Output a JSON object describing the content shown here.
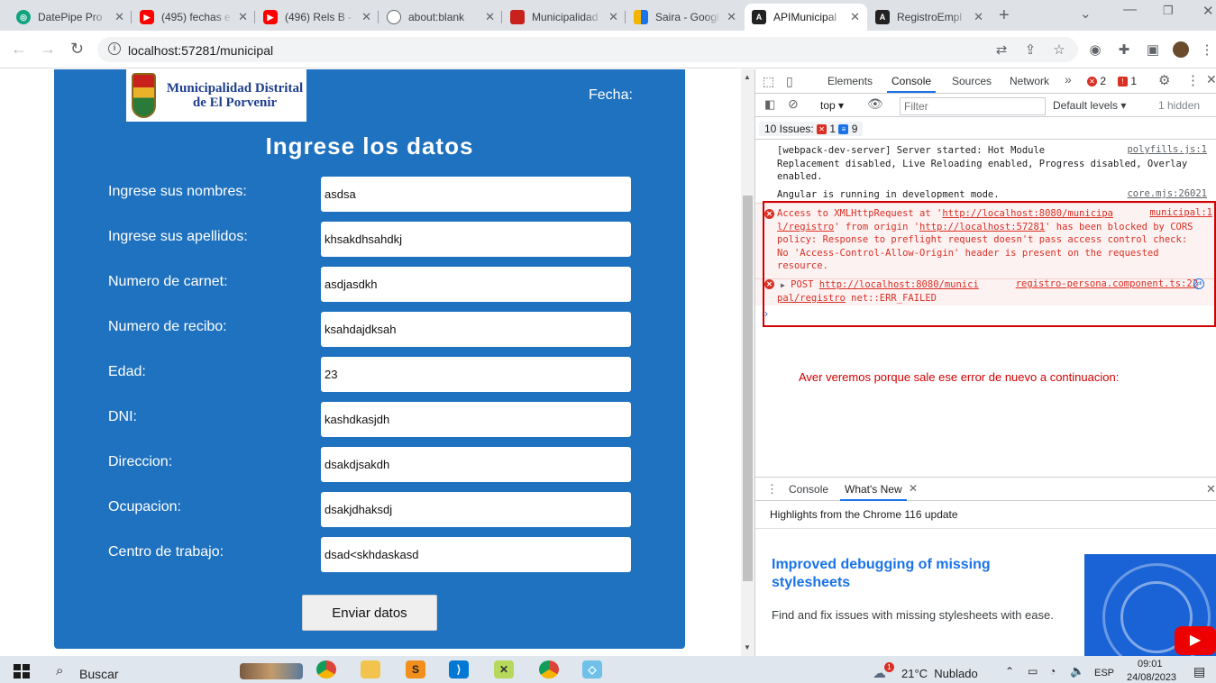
{
  "browser": {
    "tabs": [
      {
        "title": "DatePipe Pro",
        "icon": "chatgpt-icon"
      },
      {
        "title": "(495) fechas e",
        "icon": "youtube-icon"
      },
      {
        "title": "(496) Rels B -",
        "icon": "youtube-icon"
      },
      {
        "title": "about:blank",
        "icon": "globe-icon"
      },
      {
        "title": "Municipalidad",
        "icon": "municipal-crest-icon"
      },
      {
        "title": "Saira - Googl",
        "icon": "google-sheets-icon"
      },
      {
        "title": "APIMunicipal",
        "icon": "angular-icon"
      },
      {
        "title": "RegistroEmpl",
        "icon": "angular-icon"
      }
    ],
    "active_tab": 6,
    "url": "localhost:57281/municipal"
  },
  "form": {
    "logo_text": "Municipalidad Distrital de El Porvenir",
    "fecha_label": "Fecha:",
    "title": "Ingrese los datos",
    "fields": [
      {
        "label": "Ingrese sus nombres:",
        "value": "asdsa"
      },
      {
        "label": "Ingrese sus apellidos:",
        "value": "khsakdhsahdkj"
      },
      {
        "label": "Numero de carnet:",
        "value": "asdjasdkh"
      },
      {
        "label": "Numero de recibo:",
        "value": "ksahdajdksah"
      },
      {
        "label": "Edad:",
        "value": "23"
      },
      {
        "label": "DNI:",
        "value": "kashdkasjdh"
      },
      {
        "label": "Direccion:",
        "value": "dsakdjsakdh"
      },
      {
        "label": "Ocupacion:",
        "value": "dsakjdhaksdj"
      },
      {
        "label": "Centro de trabajo:",
        "value": "dsad<skhdaskasd"
      }
    ],
    "submit_label": "Enviar datos"
  },
  "devtools": {
    "tabs": [
      "Elements",
      "Console",
      "Sources",
      "Network"
    ],
    "active_tab": "Console",
    "error_count": "2",
    "issue_badge_count": "1",
    "context": "top",
    "filter_placeholder": "Filter",
    "levels": "Default levels",
    "hidden": "1 hidden",
    "issues_label": "10 Issues:",
    "issues_errors": "1",
    "issues_info": "9",
    "messages": {
      "m1_l1": "[webpack-dev-server] Server started: Hot Module",
      "m1_l2": "Replacement disabled, Live Reloading enabled, Progress disabled, Overlay",
      "m1_l3": "enabled.",
      "m1_src": "polyfills.js:1",
      "m2": "Angular is running in development mode.",
      "m2_src": "core.mjs:26021",
      "e1_l1_a": "Access to XMLHttpRequest at '",
      "e1_l1_link": "http://localhost:8080/municipa",
      "e1_l1_src": "municipal:1",
      "e1_l2_a": "l/registro",
      "e1_l2_b": "' from origin '",
      "e1_l2_link": "http://localhost:57281",
      "e1_l2_c": "' has been blocked by CORS",
      "e1_l3": "policy: Response to preflight request doesn't pass access control check:",
      "e1_l4": "No 'Access-Control-Allow-Origin' header is present on the requested",
      "e1_l5": "resource.",
      "e2_a": "POST ",
      "e2_link": "http://localhost:8080/munici",
      "e2_src": "registro-persona.component.ts:22",
      "e2_l2_link": "pal/registro",
      "e2_l2_b": " net::ERR_FAILED"
    },
    "annotation": "Aver veremos porque sale ese error de nuevo  a continuacion:",
    "drawer": {
      "tabs": [
        "Console",
        "What's New"
      ],
      "highlights": "Highlights from the Chrome 116 update",
      "article_title": "Improved debugging of missing stylesheets",
      "article_desc": "Find and fix issues with missing stylesheets with ease."
    }
  },
  "taskbar": {
    "search": "Buscar",
    "weather": "21°C  Nublado",
    "weather_badge": "1",
    "lang": "ESP",
    "time": "09:01",
    "date": "24/08/2023"
  },
  "colors": {
    "form_bg": "#1f72bf",
    "error_red": "#d93025",
    "annotation_red": "#d10000"
  }
}
